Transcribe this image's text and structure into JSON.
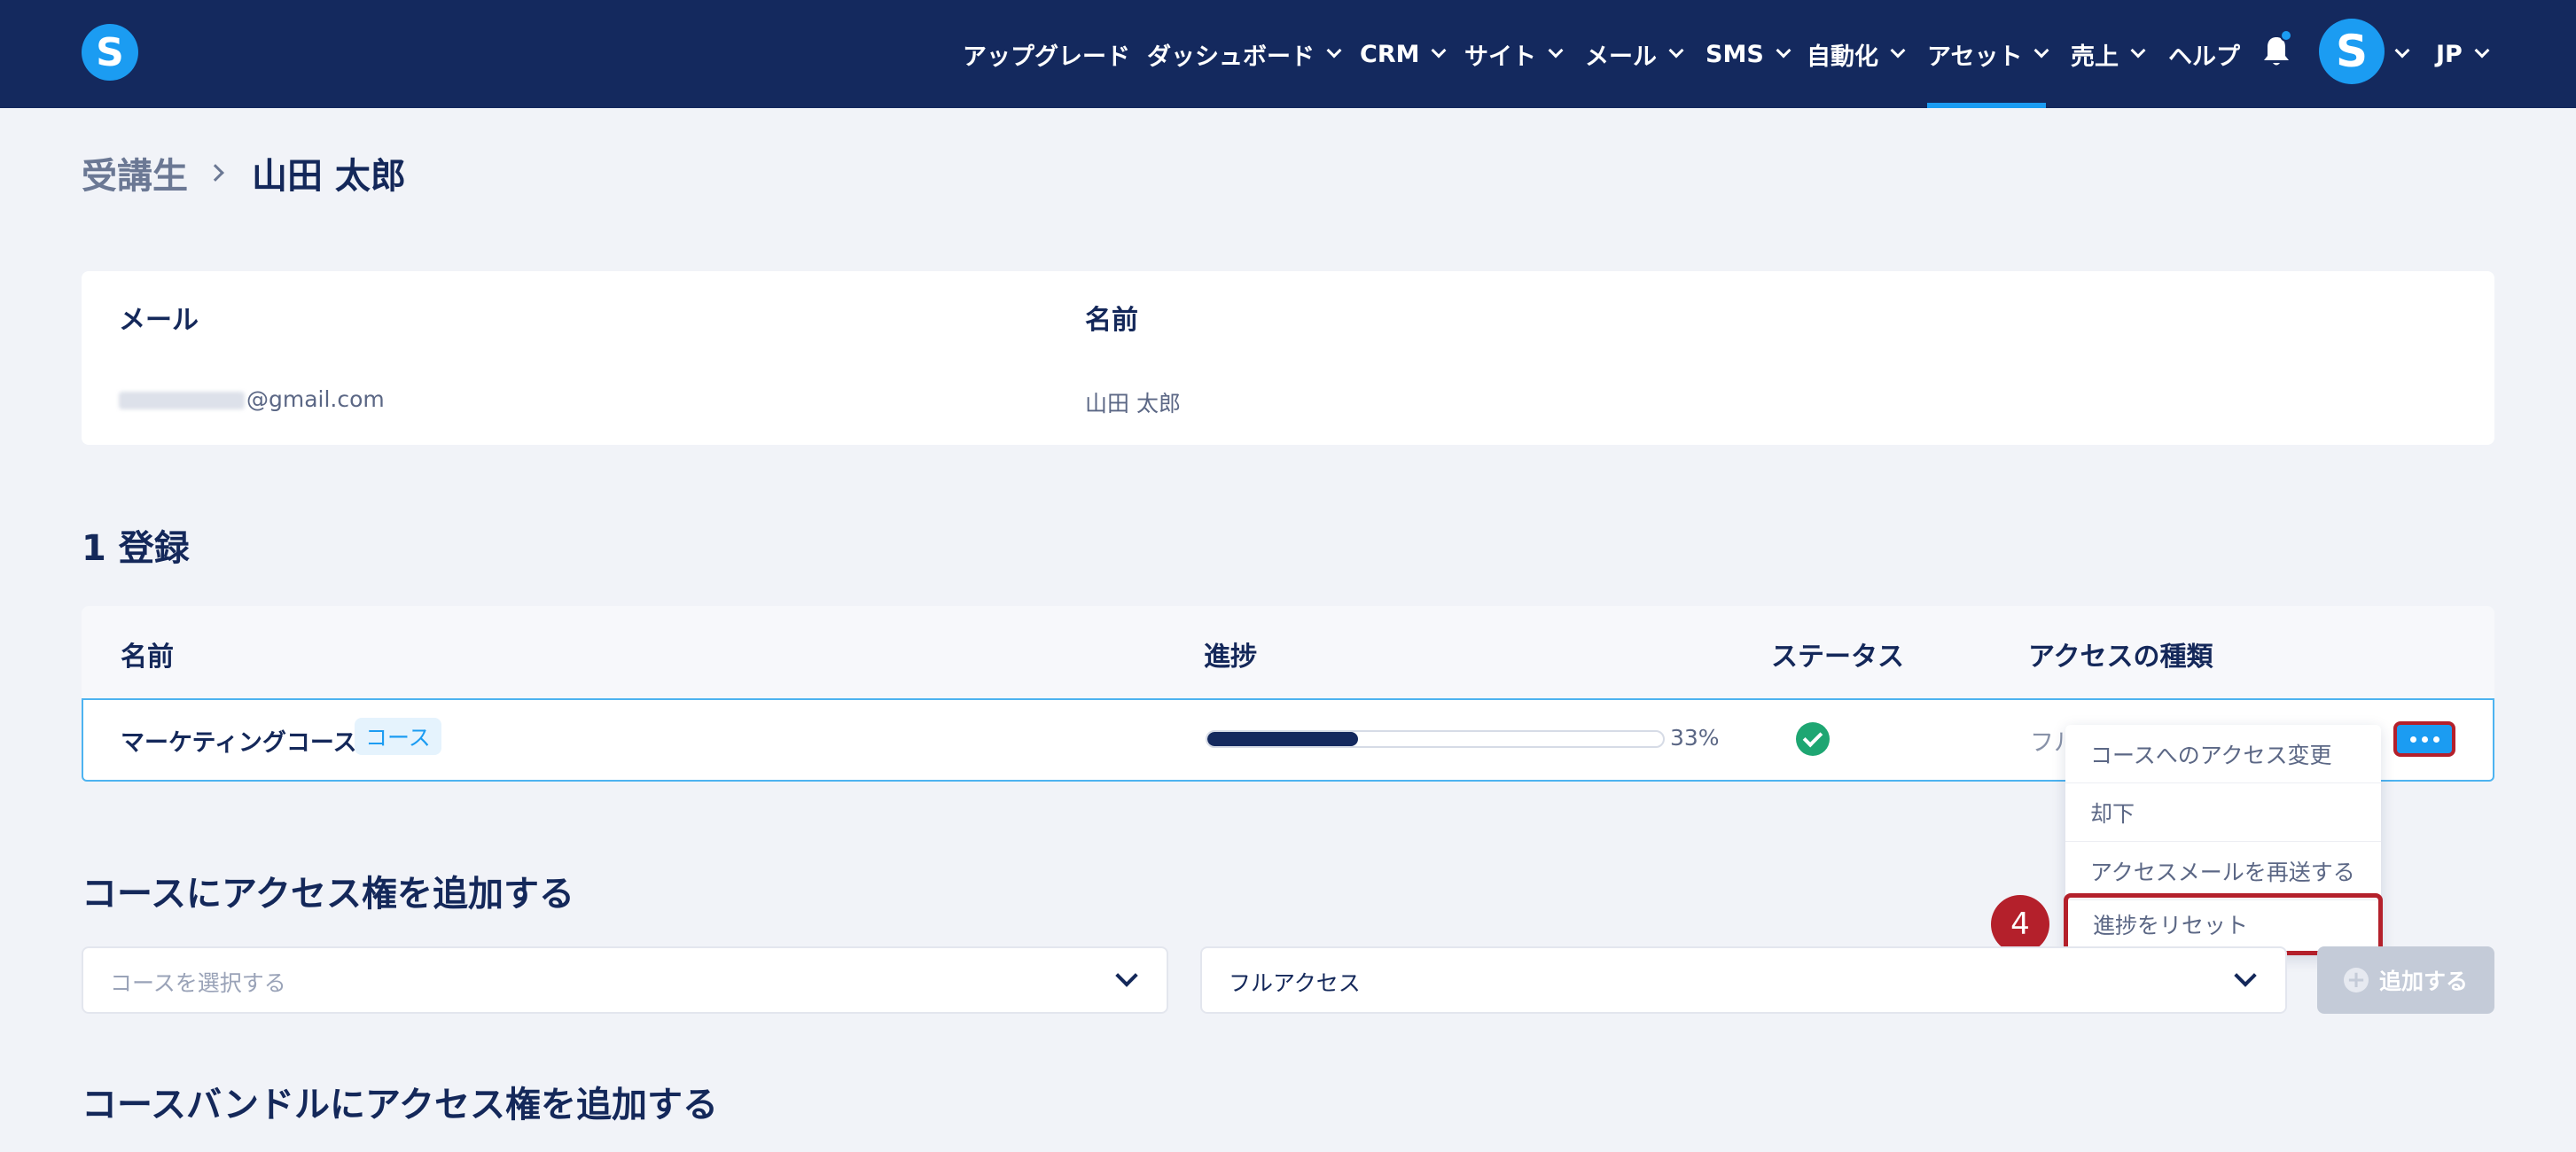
{
  "nav": {
    "upgrade": "アップグレード",
    "dashboard": "ダッシュボード",
    "crm": "CRM",
    "site": "サイト",
    "mail": "メール",
    "sms": "SMS",
    "automation": "自動化",
    "assets": "アセット",
    "sales": "売上",
    "help": "ヘルプ",
    "language": "JP",
    "avatar_letter": "S",
    "logo_letter": "S",
    "active_item": "アセット"
  },
  "breadcrumb": {
    "parent": "受講生",
    "current": "山田 太郎"
  },
  "student": {
    "email_label": "メール",
    "name_label": "名前",
    "email_value": "@gmail.com",
    "name_value": "山田 太郎"
  },
  "enrollments": {
    "heading": "1 登録",
    "columns": [
      "名前",
      "進捗",
      "ステータス",
      "アクセスの種類"
    ],
    "rows": [
      {
        "name": "マーケティングコース",
        "tag": "コース",
        "progress_fraction": 0.33,
        "progress_text": "33%",
        "status": "check-icon",
        "access_type": "フル"
      }
    ]
  },
  "row_menu": {
    "items": [
      "コースへのアクセス変更",
      "却下",
      "アクセスメールを再送する",
      "進捗をリセット"
    ],
    "highlighted_index": 3,
    "step_badge": "4"
  },
  "add_course_access": {
    "heading": "コースにアクセス権を追加する",
    "course_placeholder": "コースを選択する",
    "access_value": "フルアクセス",
    "add_label": "追加する"
  },
  "add_bundle_access": {
    "heading": "コースバンドルにアクセス権を追加する"
  },
  "colors": {
    "nav_bg": "#14295e",
    "accent": "#1b9cf2",
    "highlight": "#b4202b",
    "success": "#1ea672"
  }
}
